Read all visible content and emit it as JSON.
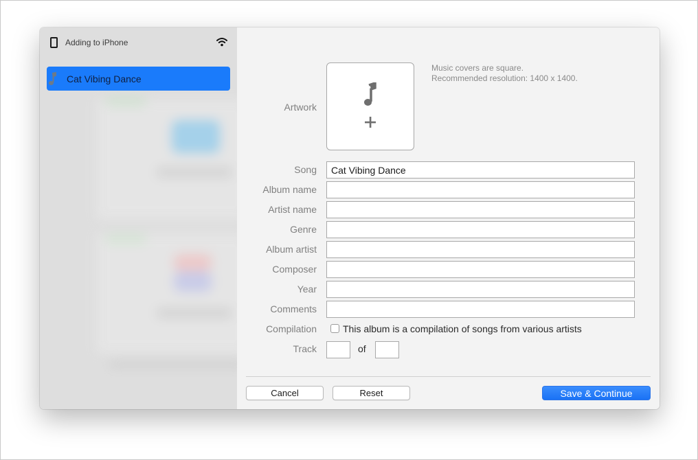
{
  "sidebar": {
    "title": "Adding to iPhone",
    "items": [
      {
        "label": "Cat Vibing Dance",
        "selected": true
      }
    ],
    "icons": {
      "device": "iphone-icon",
      "status": "wifi-icon",
      "item": "music-note-icon"
    }
  },
  "form": {
    "artwork": {
      "label": "Artwork",
      "hint_line1": "Music covers are square.",
      "hint_line2": "Recommended resolution: 1400 x 1400.",
      "icons": [
        "music-note-icon",
        "plus-icon"
      ]
    },
    "fields": [
      {
        "key": "song",
        "label": "Song",
        "value": "Cat Vibing Dance",
        "placeholder": ""
      },
      {
        "key": "album_name",
        "label": "Album name",
        "value": "",
        "placeholder": ""
      },
      {
        "key": "artist_name",
        "label": "Artist name",
        "value": "",
        "placeholder": ""
      },
      {
        "key": "genre",
        "label": "Genre",
        "value": "",
        "placeholder": ""
      },
      {
        "key": "album_artist",
        "label": "Album artist",
        "value": "",
        "placeholder": ""
      },
      {
        "key": "composer",
        "label": "Composer",
        "value": "",
        "placeholder": ""
      },
      {
        "key": "year",
        "label": "Year",
        "value": "",
        "placeholder": ""
      },
      {
        "key": "comments",
        "label": "Comments",
        "value": "",
        "placeholder": ""
      }
    ],
    "compilation": {
      "label": "Compilation",
      "checkbox_label": "This album is a compilation of songs from various artists",
      "checked": false
    },
    "track": {
      "label": "Track",
      "number": "",
      "of_label": "of",
      "total": ""
    }
  },
  "buttons": {
    "cancel": "Cancel",
    "reset": "Reset",
    "save": "Save & Continue"
  },
  "colors": {
    "accent": "#1a7bfb",
    "sidebar_bg": "#dedede",
    "panel_bg": "#f3f3f3",
    "label_text": "#808080"
  }
}
